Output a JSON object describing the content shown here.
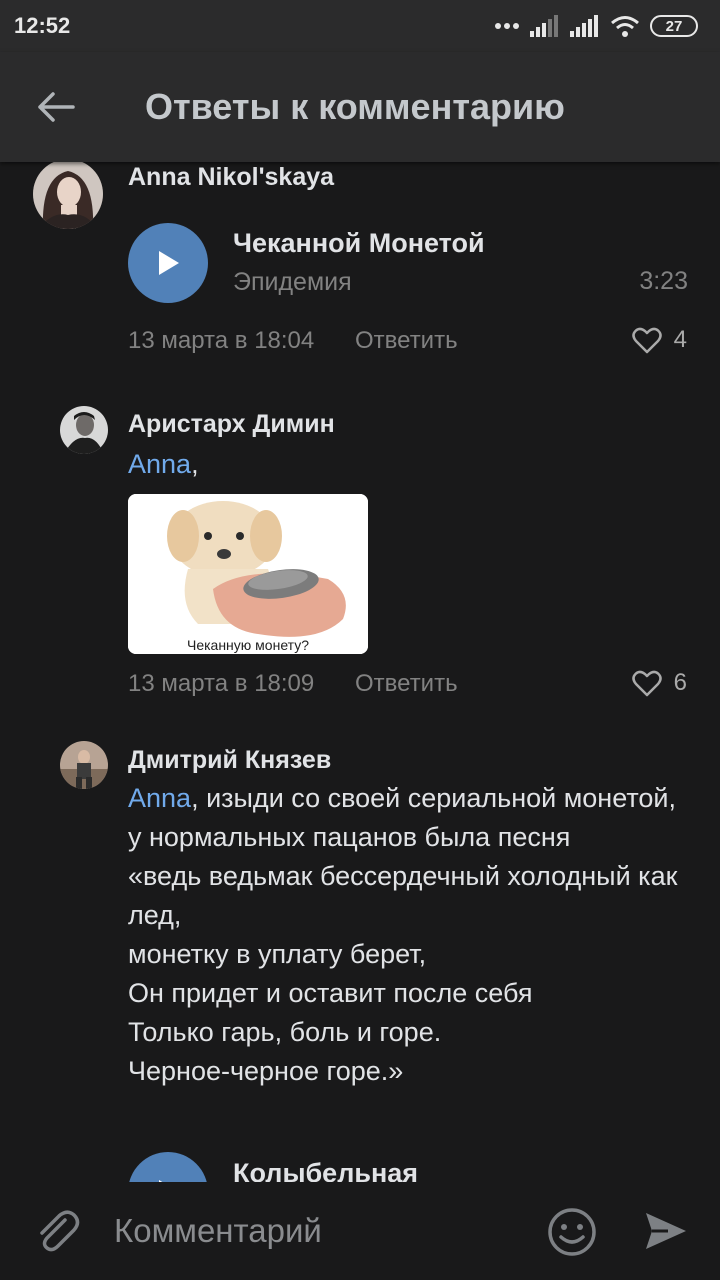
{
  "status_bar": {
    "time": "12:52",
    "battery": "27"
  },
  "header": {
    "title": "Ответы к комментарию"
  },
  "comments": [
    {
      "author": "Anna Nikol'skaya",
      "audio": {
        "title": "Чеканной Монетой",
        "artist": "Эпидемия",
        "duration": "3:23"
      },
      "date": "13 марта в 18:04",
      "reply_label": "Ответить",
      "likes": "4"
    },
    {
      "author": "Аристарх Димин",
      "mention": "Anna",
      "text": ",",
      "image_caption": "Чеканную монету?",
      "date": "13 марта в 18:09",
      "reply_label": "Ответить",
      "likes": "6"
    },
    {
      "author": "Дмитрий Князев",
      "mention": "Anna",
      "text": ", изыди со своей сериальной монетой, у нормальных пацанов была песня\n«ведь ведьмак бессердечный холодный как лед,\nмонетку в уплату берет,\nОн придет и оставит после себя\nТолько гарь, боль и горе.\nЧерное-черное горе.»",
      "audio": {
        "title": "Колыбельная"
      }
    }
  ],
  "composer": {
    "placeholder": "Комментарий"
  },
  "colors": {
    "accent": "#5181b8",
    "link": "#71aaeb",
    "background": "#19191a",
    "header": "#2b2b2c",
    "muted": "#828282"
  }
}
